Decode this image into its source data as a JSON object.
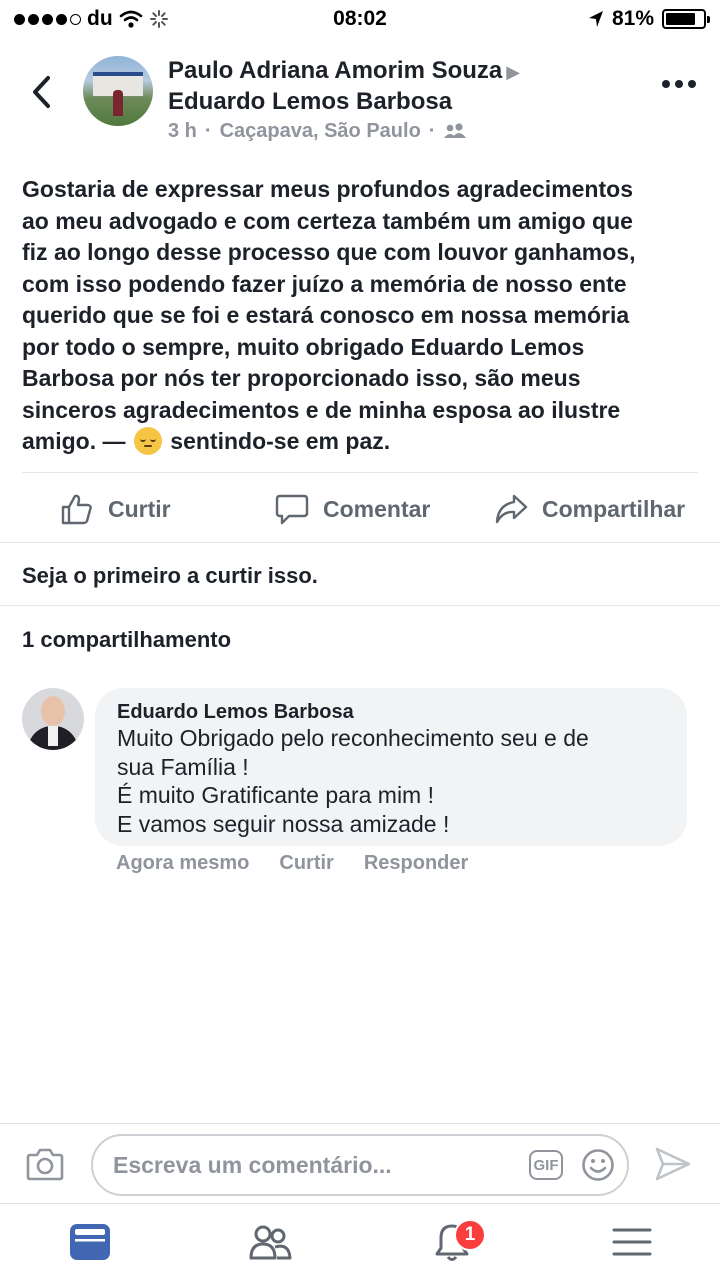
{
  "status_bar": {
    "carrier": "du",
    "time": "08:02",
    "battery": "81%",
    "battery_level": 0.81
  },
  "post": {
    "author": "Paulo Adriana Amorim Souza",
    "recipient": "Eduardo Lemos Barbosa",
    "time_ago": "3 h",
    "location": "Caçapava, São Paulo",
    "audience_icon": "friends-icon",
    "text_lines": [
      "Gostaria de expressar meus profundos agradecimentos",
      "ao meu advogado e com certeza também um amigo que",
      "fiz ao longo desse processo que com louvor ganhamos,",
      "com isso podendo fazer juízo a memória de nosso ente",
      "querido que se foi e estará conosco em nossa memória"
    ],
    "text_line6_before": "por todo o sempre, muito obrigado ",
    "text_mention": "Eduardo Lemos",
    "text_line7_mention": "Barbosa",
    "text_line7_after": " por nós ter proporcionado isso, são meus",
    "text_line8": "sinceros agradecimentos e de minha esposa ao ilustre",
    "text_line9_before": "amigo. —",
    "feeling": "sentindo-se em paz."
  },
  "actions": {
    "like": "Curtir",
    "comment": "Comentar",
    "share": "Compartilhar"
  },
  "likes_summary": "Seja o primeiro a curtir isso.",
  "shares_summary": "1 compartilhamento",
  "comment": {
    "author": "Eduardo Lemos Barbosa",
    "lines": [
      "Muito Obrigado pelo reconhecimento seu e de",
      "sua Família !",
      "É muito Gratificante para mim !",
      "E vamos seguir nossa amizade !"
    ],
    "time": "Agora mesmo",
    "like": "Curtir",
    "reply": "Responder"
  },
  "composer": {
    "placeholder": "Escreva um comentário...",
    "gif_label": "GIF"
  },
  "tab_bar": {
    "notifications_badge": "1"
  },
  "colors": {
    "text": "#1d2129",
    "secondary": "#90949c",
    "active_tab": "#4267b2",
    "badge": "#fa3e3e"
  }
}
